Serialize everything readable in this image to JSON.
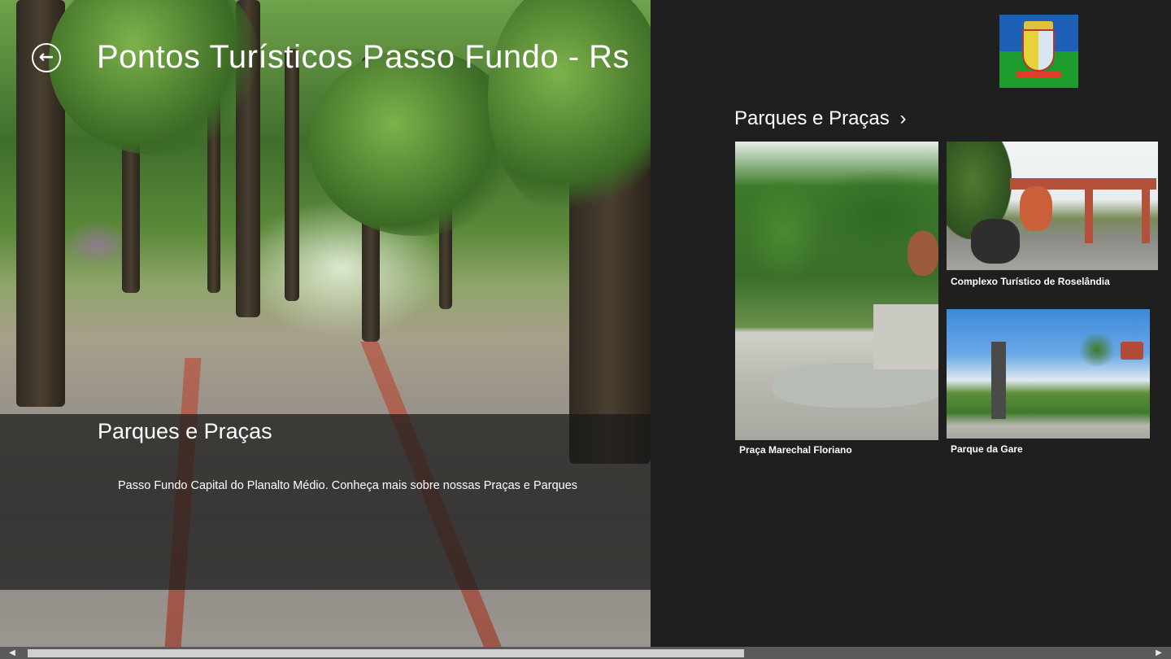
{
  "app": {
    "title": "Pontos Turísticos Passo Fundo - Rs",
    "back_icon": "back-arrow-icon"
  },
  "hero": {
    "heading": "Parques e Praças",
    "description": "Passo Fundo Capital do Planalto Médio. Conheça mais sobre nossas Praças e Parques"
  },
  "section": {
    "title": "Parques e Praças",
    "chevron": "›",
    "items": [
      {
        "caption": "Praça Marechal Floriano"
      },
      {
        "caption": "Complexo Turístico de Roselândia"
      },
      {
        "caption": "Parque da Gare"
      }
    ]
  },
  "scrollbar": {
    "left_arrow": "◀",
    "right_arrow": "▶"
  },
  "colors": {
    "background": "#1f1f1f",
    "overlay": "rgba(25,25,25,0.72)",
    "crest_blue": "#1d60b6",
    "crest_green": "#1d9b2c"
  }
}
